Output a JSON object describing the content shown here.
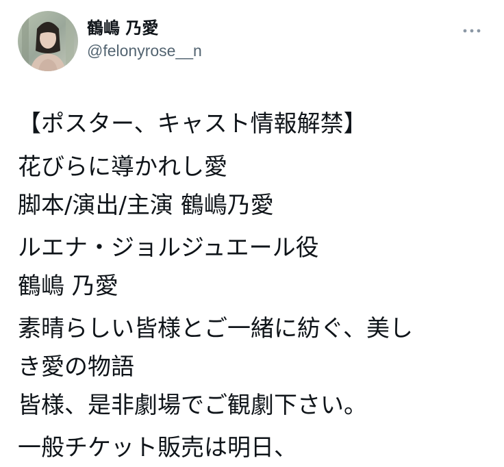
{
  "author": {
    "display_name": "鶴嶋 乃愛",
    "handle": "@felonyrose__n",
    "avatar_icon": "profile-photo-icon"
  },
  "menu": {
    "icon": "more-options-icon"
  },
  "tweet": {
    "lines": [
      "【ポスター、キャスト情報解禁】",
      "花びらに導かれし愛",
      "脚本/演出/主演 鶴嶋乃愛",
      "ルエナ・ジョルジュエール役",
      "鶴嶋 乃愛",
      "素晴らしい皆様とご一緒に紡ぐ、美し",
      "き愛の物語",
      "皆様、是非劇場でご観劇下さい。",
      "一般チケット販売は明日、"
    ]
  },
  "colors": {
    "text_primary": "#0f1419",
    "text_secondary": "#536471",
    "icon_gray": "#8b98a5"
  }
}
